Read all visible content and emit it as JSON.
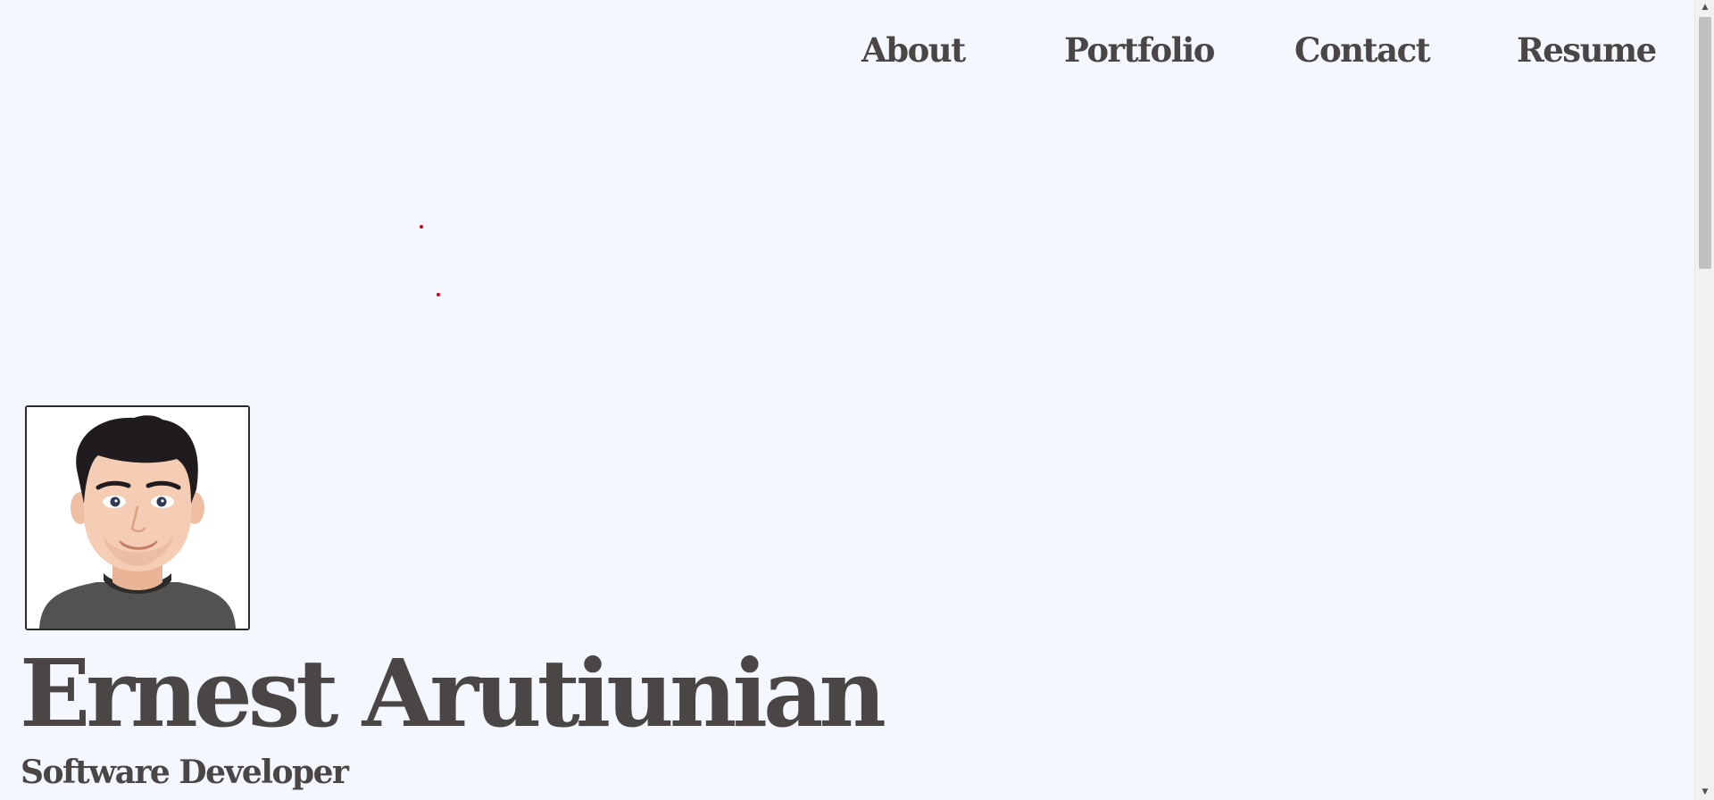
{
  "nav": {
    "items": [
      {
        "label": "About"
      },
      {
        "label": "Portfolio"
      },
      {
        "label": "Contact"
      },
      {
        "label": "Resume"
      }
    ]
  },
  "hero": {
    "avatar_icon": "avatar-illustration",
    "name": "Ernest Arutiunian",
    "title": "Software Developer"
  },
  "colors": {
    "background": "#f4f7fe",
    "text": "#4a4646",
    "particle": "#d0021b"
  },
  "scrollbar": {
    "up_icon": "scroll-up-arrow-icon",
    "down_icon": "scroll-down-arrow-icon"
  }
}
